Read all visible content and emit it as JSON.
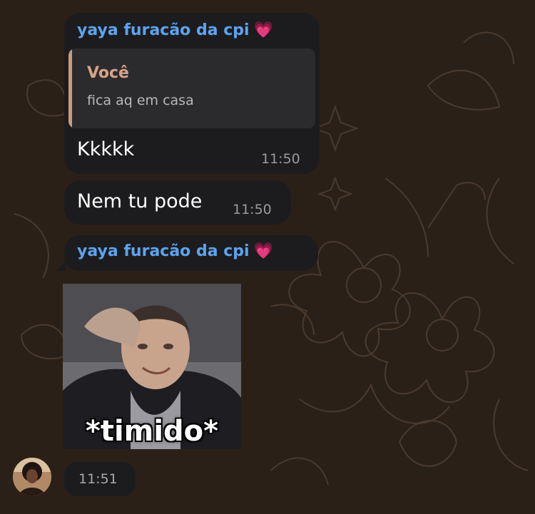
{
  "chat": {
    "message1": {
      "sender": "yaya furacão da cpi",
      "sender_emoji": "💗",
      "reply_author": "Você",
      "reply_text": "fica aq em casa",
      "text": "Kkkkk",
      "time": "11:50"
    },
    "message2": {
      "text": "Nem tu pode",
      "time": "11:50"
    },
    "message3": {
      "sender": "yaya furacão da cpi",
      "sender_emoji": "💗",
      "sticker_caption": "*timido*",
      "time": "11:51"
    }
  },
  "colors": {
    "background": "#2b2018",
    "bubble": "#1c1c1e",
    "sender_name": "#5ea3ee",
    "reply_author": "#d7a487",
    "reply_bar": "#c99c7a"
  }
}
